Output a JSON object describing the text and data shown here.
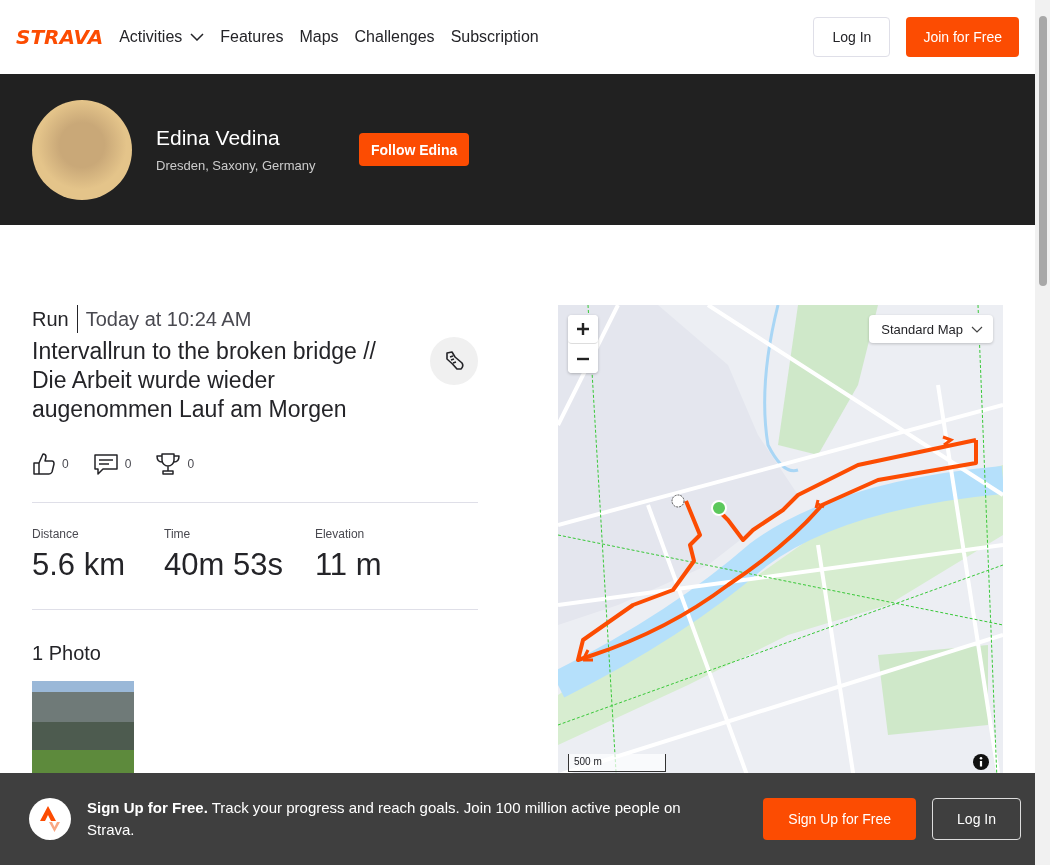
{
  "nav": {
    "logo": "STRAVA",
    "links": [
      {
        "label": "Activities",
        "dropdown": true
      },
      {
        "label": "Features",
        "dropdown": false
      },
      {
        "label": "Maps",
        "dropdown": false
      },
      {
        "label": "Challenges",
        "dropdown": false
      },
      {
        "label": "Subscription",
        "dropdown": false
      }
    ],
    "login": "Log In",
    "join": "Join for Free"
  },
  "profile": {
    "name": "Edina Vedina",
    "location": "Dresden, Saxony, Germany",
    "follow": "Follow Edina"
  },
  "activity": {
    "type": "Run",
    "date": "Today at 10:24 AM",
    "title": "Intervallrun to the broken bridge // Die Arbeit wurde wieder augenommen Lauf am Morgen",
    "kudos": "0",
    "comments": "0",
    "achievements": "0",
    "stats": [
      {
        "label": "Distance",
        "value": "5.6 km"
      },
      {
        "label": "Time",
        "value": "40m 53s"
      },
      {
        "label": "Elevation",
        "value": "11 m"
      }
    ]
  },
  "photos": {
    "heading": "1 Photo"
  },
  "map": {
    "style": "Standard Map",
    "scale": "500 m"
  },
  "banner": {
    "text": "**Sign Up for Free.** Track your progress and reach goals. Join 100 million active people on Strava.",
    "signup": "Sign Up for Free",
    "login": "Log In"
  }
}
